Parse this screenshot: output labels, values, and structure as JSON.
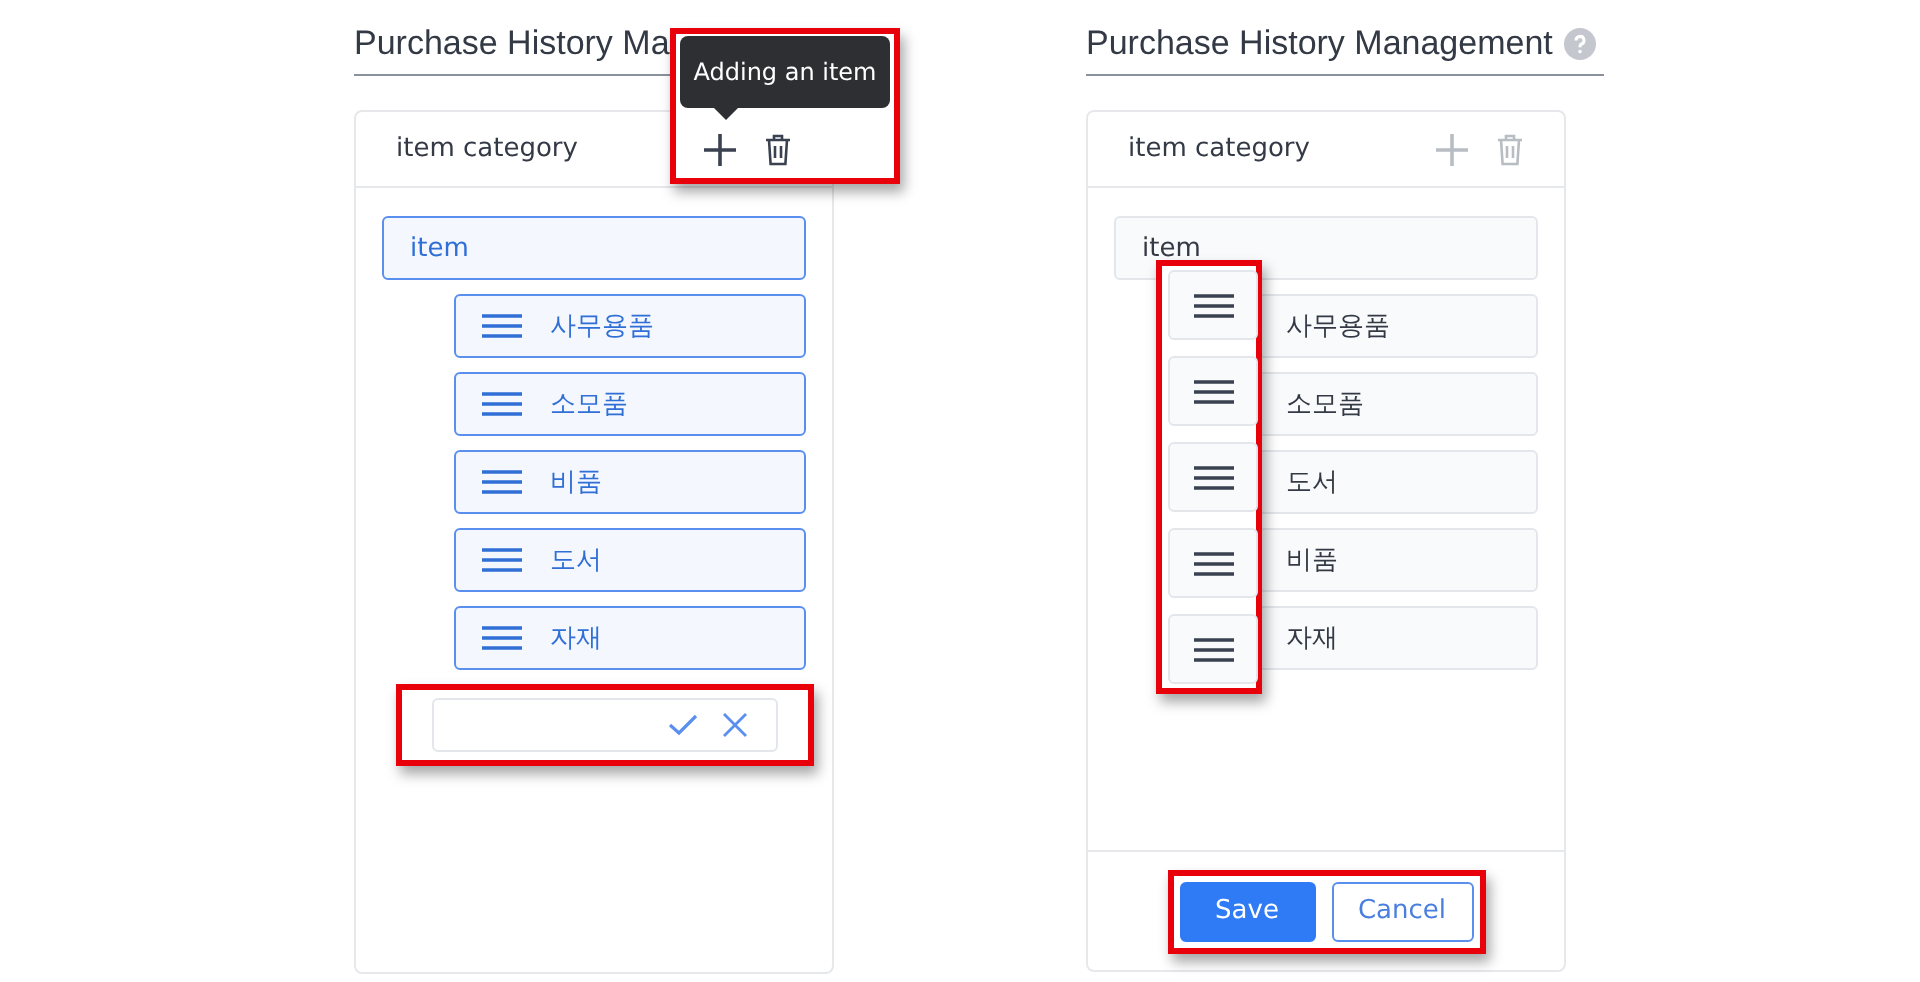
{
  "panels": [
    {
      "kind": "edit",
      "title": "Purchase History Ma",
      "tooltip": {
        "text": "Adding an item",
        "highlighted": true
      },
      "header": {
        "label": "item category",
        "actions_disabled": false
      },
      "root": {
        "label": "item",
        "selected": true,
        "children": [
          {
            "label": "사무용품"
          },
          {
            "label": "소모품"
          },
          {
            "label": "비품"
          },
          {
            "label": "도서"
          },
          {
            "label": "자재"
          }
        ]
      },
      "add_row": {
        "highlighted": true
      }
    },
    {
      "kind": "reorder",
      "title": "Purchase History Management",
      "header": {
        "label": "item category",
        "actions_disabled": true
      },
      "root": {
        "label": "item",
        "selected": false,
        "children": [
          {
            "label": "사무용품"
          },
          {
            "label": "소모품"
          },
          {
            "label": "도서"
          },
          {
            "label": "비품"
          },
          {
            "label": "자재"
          }
        ]
      },
      "handles_highlighted": true,
      "buttons": [
        {
          "label": "Save",
          "kind": "primary"
        },
        {
          "label": "Cancel",
          "kind": "secondary"
        }
      ],
      "buttons_highlighted": true
    }
  ]
}
